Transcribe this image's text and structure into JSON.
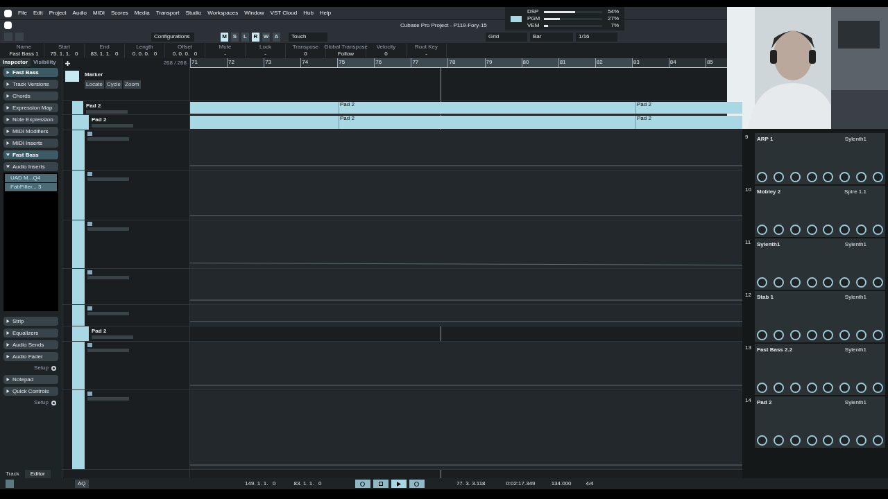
{
  "menu": [
    "File",
    "Edit",
    "Project",
    "Audio",
    "MIDI",
    "Scores",
    "Media",
    "Transport",
    "Studio",
    "Workspaces",
    "Window",
    "VST Cloud",
    "Hub",
    "Help"
  ],
  "window": {
    "title": "Cubase Pro Project - P119-Fory-15"
  },
  "toolbar": {
    "configurations": "Configurations",
    "modes": [
      {
        "label": "M",
        "on": true
      },
      {
        "label": "S",
        "on": false
      },
      {
        "label": "L",
        "on": false
      },
      {
        "label": "R",
        "on": true
      },
      {
        "label": "W",
        "on": false
      },
      {
        "label": "A",
        "on": false
      }
    ],
    "automation_mode": "Touch",
    "snap": "Grid",
    "grid": "Bar",
    "quantize": "1/16"
  },
  "performance": [
    {
      "name": "DSP",
      "level": 0.54,
      "reading": "54%"
    },
    {
      "name": "PGM",
      "level": 0.27,
      "reading": "27%"
    },
    {
      "name": "VEM",
      "level": 0.07,
      "reading": "7%"
    }
  ],
  "info_line": [
    {
      "label": "Name",
      "value": "Fast Bass 1"
    },
    {
      "label": "Start",
      "value": "75. 1. 1.   0"
    },
    {
      "label": "End",
      "value": "83. 1. 1.   0"
    },
    {
      "label": "Length",
      "value": "0. 0. 0.   0"
    },
    {
      "label": "Offset",
      "value": "0. 0. 0.   0"
    },
    {
      "label": "Mute",
      "value": "-"
    },
    {
      "label": "Lock",
      "value": "-"
    },
    {
      "label": "Transpose",
      "value": "0"
    },
    {
      "label": "Global Transpose",
      "value": "Follow"
    },
    {
      "label": "Velocity",
      "value": "0"
    },
    {
      "label": "Root Key",
      "value": "-"
    }
  ],
  "inspector": {
    "tabs": [
      {
        "label": "Inspector",
        "selected": true
      },
      {
        "label": "Visibility",
        "selected": false
      }
    ],
    "sections": [
      {
        "kind": "track",
        "label": "Fast Bass",
        "expanded": false
      },
      {
        "kind": "section",
        "label": "Track Versions",
        "expanded": false
      },
      {
        "kind": "section",
        "label": "Chords",
        "expanded": false
      },
      {
        "kind": "section",
        "label": "Expression Map",
        "expanded": false
      },
      {
        "kind": "section",
        "label": "Note Expression",
        "expanded": false
      },
      {
        "kind": "section",
        "label": "MIDI Modifiers",
        "expanded": false
      },
      {
        "kind": "section",
        "label": "MIDI Inserts",
        "expanded": false
      },
      {
        "kind": "track",
        "label": "Fast Bass",
        "expanded": true
      },
      {
        "kind": "section",
        "label": "Audio Inserts",
        "expanded": true
      }
    ],
    "inserts": [
      "UAD M...Q4",
      "FabFilter... 3"
    ],
    "sections_2": [
      {
        "kind": "section",
        "label": "Strip",
        "expanded": false
      },
      {
        "kind": "section",
        "label": "Equalizers",
        "expanded": false
      },
      {
        "kind": "section",
        "label": "Audio Sends",
        "expanded": false
      },
      {
        "kind": "section",
        "label": "Audio Fader",
        "expanded": false
      },
      {
        "kind": "setup",
        "label": "Setup"
      },
      {
        "kind": "section",
        "label": "Notepad",
        "expanded": false
      },
      {
        "kind": "section",
        "label": "Quick Controls",
        "expanded": false
      },
      {
        "kind": "setup",
        "label": "Setup"
      }
    ],
    "bottom_tabs": [
      {
        "label": "Track",
        "selected": false
      },
      {
        "label": "Editor",
        "selected": true
      }
    ]
  },
  "track_count": "268 / 268",
  "tracks": [
    {
      "kind": "marker",
      "name": "Marker",
      "buttons": [
        "Locate",
        "Cycle",
        "Zoom"
      ]
    },
    {
      "kind": "folder",
      "name": "Pad 2"
    },
    {
      "kind": "instrument",
      "name": "Pad 2"
    },
    {
      "kind": "automation"
    },
    {
      "kind": "automation"
    },
    {
      "kind": "automation"
    },
    {
      "kind": "automation"
    },
    {
      "kind": "automation"
    },
    {
      "kind": "instrument",
      "name": "Pad 2"
    },
    {
      "kind": "automation"
    },
    {
      "kind": "automation"
    }
  ],
  "ruler": [
    "71",
    "72",
    "73",
    "74",
    "75",
    "76",
    "77",
    "78",
    "79",
    "80",
    "81",
    "82",
    "83",
    "84",
    "85"
  ],
  "events": [
    {
      "label": "Pad 2"
    },
    {
      "label": "Pad 2"
    },
    {
      "label": "Pad 2"
    },
    {
      "label": "Pad 2"
    }
  ],
  "rack": [
    {
      "number": "9",
      "name": "ARP 1",
      "plugin": "Sylenth1"
    },
    {
      "number": "10",
      "name": "Mobley 2",
      "plugin": "Spire 1.1"
    },
    {
      "number": "11",
      "name": "Sylenth1",
      "plugin": "Sylenth1"
    },
    {
      "number": "12",
      "name": "Stab 1",
      "plugin": "Sylenth1"
    },
    {
      "number": "13",
      "name": "Fast Bass 2.2",
      "plugin": "Sylenth1"
    },
    {
      "number": "14",
      "name": "Pad 2",
      "plugin": "Sylenth1"
    }
  ],
  "transport": {
    "left_locator": "149. 1. 1.   0",
    "right_locator": "83. 1. 1.   0",
    "cycle": true,
    "position": "77. 3. 3.118",
    "time": "0:02:17.349",
    "tempo": "134.000",
    "signature": "4/4",
    "aq": "AQ"
  }
}
